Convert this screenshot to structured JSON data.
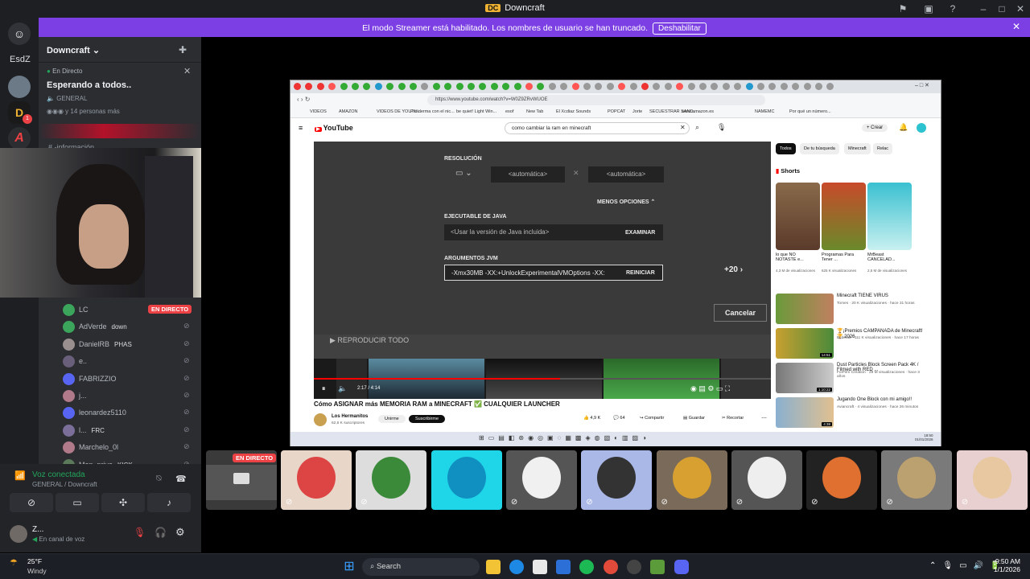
{
  "window": {
    "title": "Downcraft",
    "logo_text": "DC"
  },
  "streamer_banner": {
    "message": "El modo Streamer está habilitado. Los nombres de usuario se han truncado.",
    "button": "Deshabilitar"
  },
  "guild_sidebar": {
    "label": "EsdZ",
    "badge": "1"
  },
  "server": {
    "name": "Downcraft",
    "live_label": "En Directo",
    "stream_title": "Esperando a todos..",
    "channel": "GENERAL",
    "watchers": "y 14 personas más",
    "info_channel": "-información"
  },
  "voice_members": [
    {
      "name": "LC",
      "live": "EN DIRECTO",
      "color": "#3ba55c"
    },
    {
      "name": "AdVerde",
      "tag": "down",
      "color": "#3ba55c"
    },
    {
      "name": "DanielRB",
      "tag": "PHAS",
      "color": "#9a8f8f"
    },
    {
      "name": "e..",
      "tag": "",
      "color": "#6a5f7a"
    },
    {
      "name": "FABRIZZIO",
      "tag": "",
      "color": "#5865f2"
    },
    {
      "name": "j...",
      "tag": "",
      "color": "#b07a8a"
    },
    {
      "name": "leonardez5110",
      "tag": "",
      "color": "#5865f2"
    },
    {
      "name": "l...",
      "tag": "FRC",
      "color": "#7b6f9a"
    },
    {
      "name": "Marchelo_0l",
      "tag": "",
      "color": "#b07a8a"
    },
    {
      "name": "Mon_prive",
      "tag": "KICK",
      "color": "#5a7a5a"
    }
  ],
  "voice_panel": {
    "status": "Voz conectada",
    "location": "GENERAL / Downcraft",
    "user": "Z...",
    "user_status": "En canal de voz"
  },
  "browser": {
    "url": "https://www.youtube.com/watch?v=W0Z9ZRvWUOE",
    "bookmarks": [
      "VIDEOS",
      "AMAZON",
      "VIDEOS DE YOUTU...",
      "Proiderma con el nic...",
      "be quiet! Light Win...",
      "esof",
      "New Tab",
      "El Xcdiaz Sounds",
      "POPCAT",
      "Jorte",
      "SECUESTRAR SAND...",
      "www.amazon.es",
      "NAMEMC",
      "Por qué un número..."
    ],
    "search_query": "como cambiar la ram en minecraft",
    "create": "Crear",
    "yt_logo": "YouTube"
  },
  "launcher_dialog": {
    "resolution_label": "RESOLUCIÓN",
    "res_w": "<automática>",
    "res_h": "<automática>",
    "less_options": "MENOS OPCIONES",
    "java_label": "EJECUTABLE DE JAVA",
    "java_value": "<Usar la versión de Java incluida>",
    "browse": "EXAMINAR",
    "jvm_label": "ARGUMENTOS JVM",
    "jvm_value": "-Xmx30MB -XX:+UnlockExperimentalVMOptions -XX:",
    "reset": "REINICIAR",
    "plus_count": "+20",
    "cancel": "Cancelar",
    "play_all": "REPRODUCIR TODO",
    "time": "2:17 / 4:14"
  },
  "video": {
    "title": "Cómo ASIGNAR más MEMORIA RAM a MINECRAFT ✅ CUALQUIER LAUNCHER",
    "channel": "Los Hermanitos",
    "subs": "62,6 K suscriptores",
    "join": "Unirme",
    "subscribe": "Suscribirme",
    "likes": "4,9 K",
    "comments": "64",
    "share": "Compartir",
    "save": "Guardar",
    "clip": "Recortar"
  },
  "yt_sidebar": {
    "chips": [
      "Todos",
      "De tu búsqueda",
      "Minecraft",
      "Relac"
    ],
    "shorts_label": "Shorts",
    "shorts": [
      {
        "title": "lo que NO NOTASTE e...",
        "views": "4,3 M de visualizaciones"
      },
      {
        "title": "Programas Para Tener ...",
        "views": "625 K visualizaciones"
      },
      {
        "title": "MrBeast CANCELAD...",
        "views": "2,5 M de visualizaciones"
      }
    ],
    "videos": [
      {
        "title": "Minecraft TIENE VIRUS",
        "meta": "Tomes · 20 K visualizaciones · hace 31 horas",
        "dur": ""
      },
      {
        "title": "🏆¡Premios CAMPANADA de Minecraft! 🏆 2026",
        "meta": "Bcdcraft · 111 K visualizaciones · hace 17 horas",
        "dur": "14:51"
      },
      {
        "title": "Dust Particles Block Screen Pack 4K / Filmed with RED ...",
        "meta": "ForFilm Creation · 29 M visualizaciones · hace 3 años",
        "dur": "1:10:22"
      },
      {
        "title": "Jugando One Block con mi amigo!!",
        "meta": "Aviancraft · 4 visualizaciones · hace 26 minutos",
        "dur": "4:38"
      }
    ]
  },
  "tiles": {
    "live_badge": "EN DIRECTO"
  },
  "taskbar": {
    "weather_temp": "25°F",
    "weather_desc": "Windy",
    "search": "Search",
    "time": "9:50 AM",
    "date": "1/1/2026",
    "inner_time": "18:50",
    "inner_date": "01/01/2026"
  }
}
